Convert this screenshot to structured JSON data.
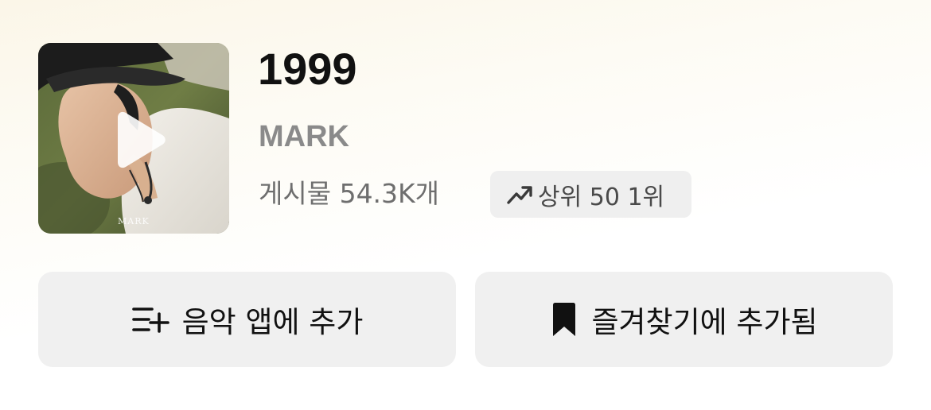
{
  "song": {
    "title": "1999",
    "artist": "MARK",
    "post_count": "게시물 54.3K개",
    "cover_text": "MARK"
  },
  "chart_badge": {
    "icon": "trending-up-icon",
    "label": "상위 50 1위"
  },
  "actions": {
    "add_to_music_app": {
      "icon": "playlist-add-icon",
      "label": "음악 앱에 추가"
    },
    "favorite": {
      "icon": "bookmark-icon",
      "label": "즐겨찾기에 추가됨"
    }
  },
  "colors": {
    "title": "#111111",
    "artist": "#8a8a8a",
    "secondary_text": "#6e6e6e",
    "badge_bg": "#efefef",
    "button_bg": "#f0f0f0"
  }
}
